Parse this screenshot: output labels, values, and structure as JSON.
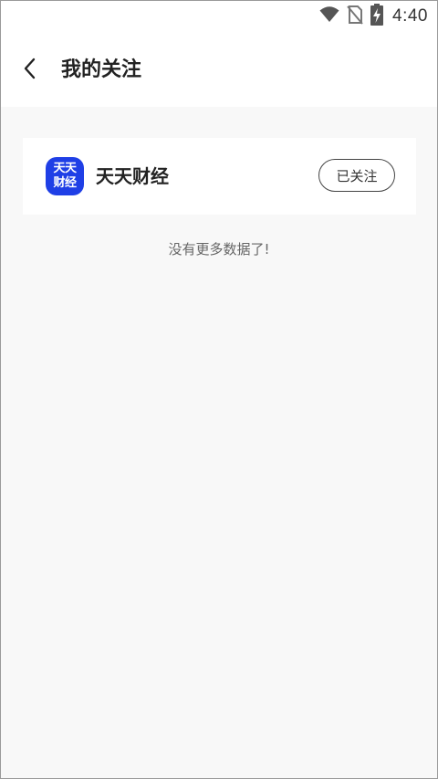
{
  "status_bar": {
    "time": "4:40",
    "icons": [
      "wifi-icon",
      "no-sim-icon",
      "battery-charging-icon"
    ]
  },
  "header": {
    "back_icon": "chevron-left-icon",
    "title": "我的关注"
  },
  "follow_list": [
    {
      "logo_text_line1": "天天",
      "logo_text_line2": "财经",
      "logo_color": "#1f3fe6",
      "name": "天天财经",
      "follow_button_label": "已关注"
    }
  ],
  "footer_message": "没有更多数据了!"
}
